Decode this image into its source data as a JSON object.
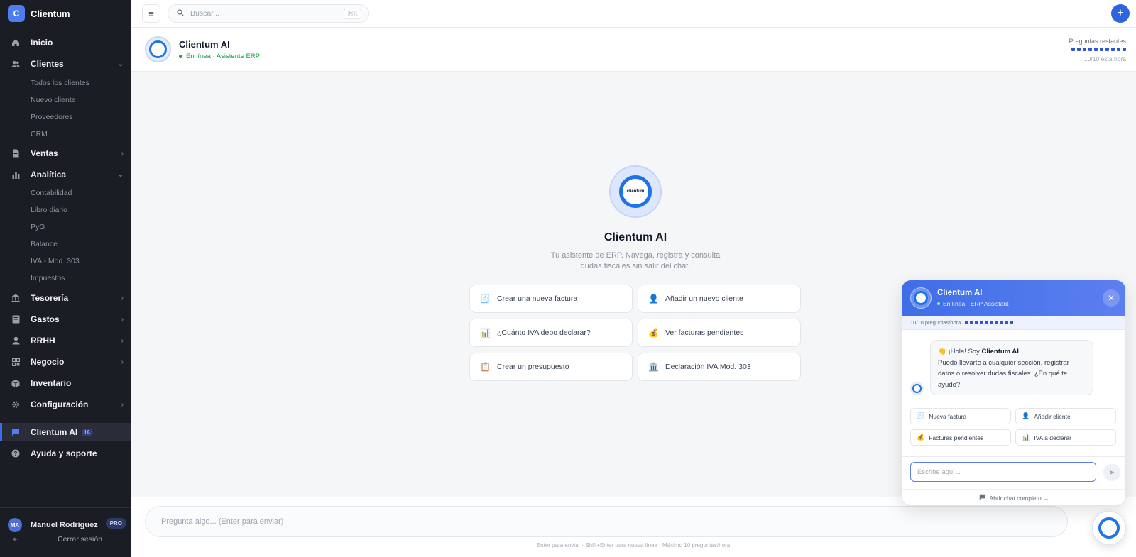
{
  "brand": {
    "logo_letter": "C",
    "name": "Clientum"
  },
  "sidebar": {
    "items": [
      {
        "label": "Inicio",
        "icon": "home-icon"
      },
      {
        "label": "Clientes",
        "icon": "users-icon"
      },
      {
        "label": "Ventas",
        "icon": "document-icon"
      },
      {
        "label": "Analítica",
        "icon": "bar-chart-icon"
      },
      {
        "label": "Tesorería",
        "icon": "bank-icon"
      },
      {
        "label": "Gastos",
        "icon": "receipt-icon"
      },
      {
        "label": "RRHH",
        "icon": "person-icon"
      },
      {
        "label": "Negocio",
        "icon": "grid-icon"
      },
      {
        "label": "Inventario",
        "icon": "box-icon"
      },
      {
        "label": "Configuración",
        "icon": "gear-icon"
      },
      {
        "label": "Clientum AI",
        "icon": "chat-icon",
        "badge": "IA",
        "active": true
      },
      {
        "label": "Ayuda y soporte",
        "icon": "help-icon"
      }
    ],
    "clientes_sub": [
      "Todos los clientes",
      "Nuevo cliente",
      "Proveedores",
      "CRM"
    ],
    "analitica_sub": [
      "Contabilidad",
      "Libro diario",
      "PyG",
      "Balance",
      "IVA - Mod. 303",
      "Impuestos"
    ],
    "user": {
      "initials": "MA",
      "name": "Manuel Rodríguez",
      "plan": "PRO"
    },
    "logout_label": "Cerrar sesión"
  },
  "topbar": {
    "search_placeholder": "Buscar...",
    "shortcut": "⌘K"
  },
  "chat_header": {
    "title": "Clientum AI",
    "status": "En línea · Asistente ERP",
    "quota_label": "Preguntas restantes",
    "quota_sub": "10/10 esta hora",
    "quota_remaining": 10,
    "quota_total": 10
  },
  "hero": {
    "logo_text": "clientum",
    "title": "Clientum AI",
    "subtitle": "Tu asistente de ERP. Navega, registra y consulta dudas fiscales sin salir del chat."
  },
  "suggestions": [
    {
      "emoji": "🧾",
      "label": "Crear una nueva factura"
    },
    {
      "emoji": "👤",
      "label": "Añadir un nuevo cliente"
    },
    {
      "emoji": "📊",
      "label": "¿Cuánto IVA debo declarar?"
    },
    {
      "emoji": "💰",
      "label": "Ver facturas pendientes"
    },
    {
      "emoji": "📋",
      "label": "Crear un presupuesto"
    },
    {
      "emoji": "🏛️",
      "label": "Declaración IVA Mod. 303"
    }
  ],
  "composer": {
    "placeholder": "Pregunta algo... (Enter para enviar)",
    "hint": "Enter para enviar · Shift+Enter para nueva línea · Máximo 10 preguntas/hora"
  },
  "widget": {
    "title": "Clientum AI",
    "status": "En línea · ERP Assistant",
    "quota": "10/10 preguntas/hora",
    "greeting_emoji": "👋",
    "greeting_prefix": "¡Hola! Soy",
    "greeting_name": "Clientum AI",
    "greeting_body": "Puedo llevarte a cualquier sección, registrar datos o resolver dudas fiscales. ¿En qué te ayudo?",
    "chips": [
      {
        "emoji": "🧾",
        "label": "Nueva factura"
      },
      {
        "emoji": "👤",
        "label": "Añadir cliente"
      },
      {
        "emoji": "💰",
        "label": "Facturas pendientes"
      },
      {
        "emoji": "📊",
        "label": "IVA a declarar"
      }
    ],
    "input_placeholder": "Escribe aquí...",
    "footer_link": "Abrir chat completo →"
  }
}
